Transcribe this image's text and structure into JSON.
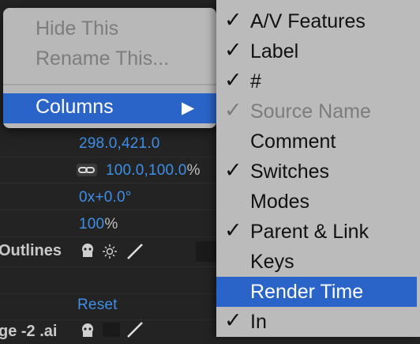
{
  "background_panel": {
    "values": {
      "position": "298.0,421.0",
      "scale": "100.0,100.0",
      "scale_unit": "%",
      "rotation": "0x+0.0°",
      "opacity": "100",
      "opacity_unit": "%",
      "reset": "Reset"
    },
    "labels": {
      "outlines": "Outlines",
      "layer_name": "ge -2 .ai"
    },
    "icons": {
      "shy": "puppet-icon",
      "chain": "link-icon",
      "switch": "sun-icon",
      "slash": "slash-icon"
    }
  },
  "context_menu": {
    "items": [
      {
        "label": "Hide This",
        "enabled": false
      },
      {
        "label": "Rename This...",
        "enabled": false
      }
    ],
    "columns": {
      "label": "Columns",
      "arrow": "▶"
    }
  },
  "columns_submenu": {
    "items": [
      {
        "label": "A/V Features",
        "checked": true,
        "enabled": true
      },
      {
        "label": "Label",
        "checked": true,
        "enabled": true
      },
      {
        "label": "#",
        "checked": true,
        "enabled": true
      },
      {
        "label": "Source Name",
        "checked": true,
        "enabled": false
      },
      {
        "label": "Comment",
        "checked": false,
        "enabled": true
      },
      {
        "label": "Switches",
        "checked": true,
        "enabled": true
      },
      {
        "label": "Modes",
        "checked": false,
        "enabled": true
      },
      {
        "label": "Parent & Link",
        "checked": true,
        "enabled": true
      },
      {
        "label": "Keys",
        "checked": false,
        "enabled": true
      },
      {
        "label": "Render Time",
        "checked": false,
        "enabled": true,
        "highlighted": true
      },
      {
        "label": "In",
        "checked": true,
        "enabled": true
      }
    ],
    "check_glyph": "✓"
  },
  "colors": {
    "highlight": "#2a64c8",
    "value_blue": "#3f8fe8",
    "menu_bg": "#bbbbbb",
    "panel_bg": "#232323"
  }
}
